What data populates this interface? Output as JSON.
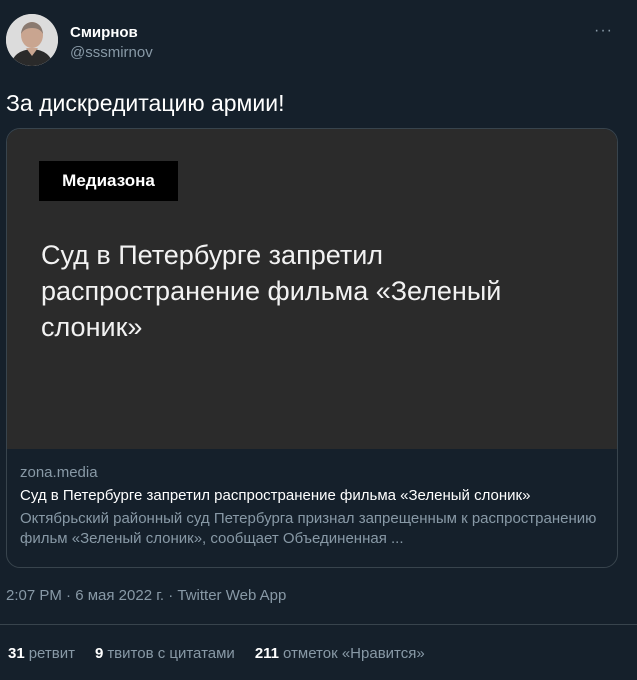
{
  "tweet": {
    "author": {
      "display_name": "Смирнов",
      "handle": "@sssmirnov",
      "avatar_icon": "person-avatar"
    },
    "more_icon": "more-horizontal-icon",
    "text": "За дискредитацию армии!",
    "card": {
      "brand": "Медиазона",
      "image_headline": "Суд в Петербурге запретил распространение фильма «Зеленый слоник»",
      "domain": "zona.media",
      "title": "Суд в Петербурге запретил распространение фильма «Зеленый слоник»",
      "description": "Октябрьский районный суд Петербурга признал запрещенным к распространению фильм «Зеленый слоник», сообщает Объединенная ..."
    },
    "meta": {
      "time": "2:07 PM",
      "separator": "·",
      "date": "6 мая 2022 г.",
      "app": "Twitter Web App"
    },
    "stats": {
      "retweets_count": "31",
      "retweets_label": "ретвит",
      "quotes_count": "9",
      "quotes_label": "твитов с цитатами",
      "likes_count": "211",
      "likes_label": "отметок «Нравится»"
    }
  },
  "colors": {
    "background": "#15202b",
    "secondary_text": "#8899a6",
    "border": "#38444d",
    "card_image_bg": "#2b2b2b",
    "brand_bg": "#000000"
  }
}
